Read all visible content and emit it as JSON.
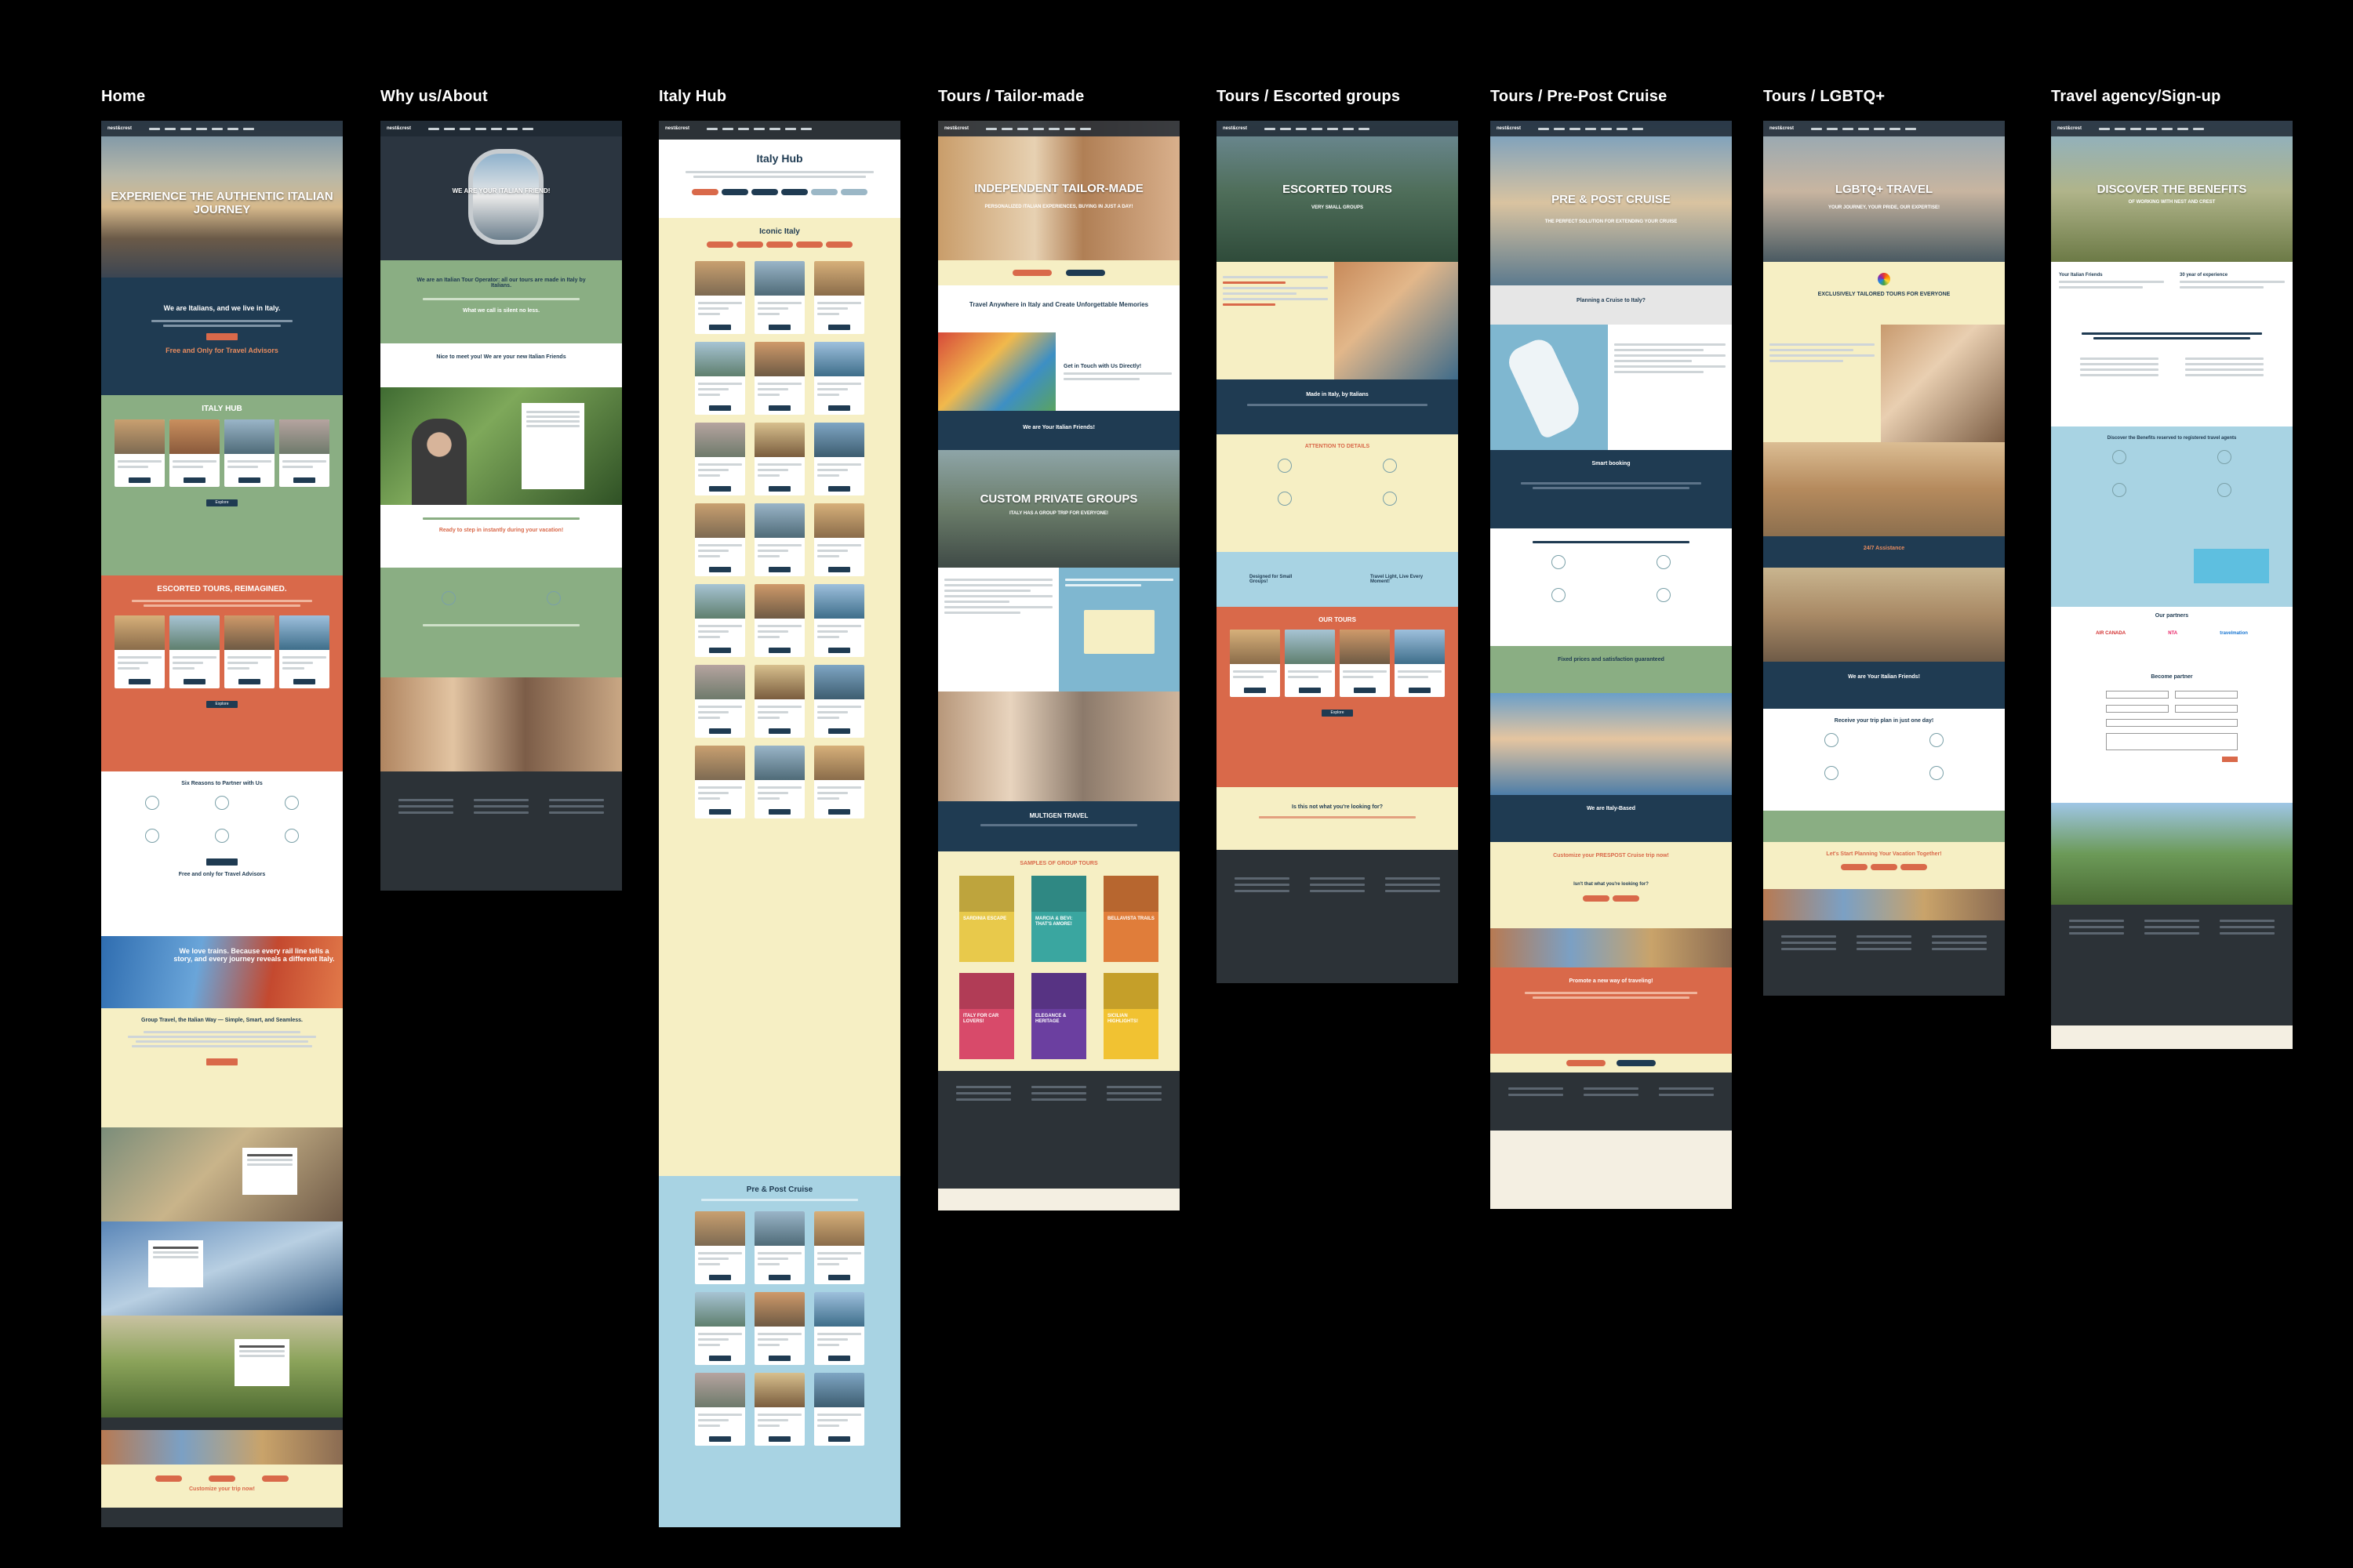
{
  "board": {
    "titles": [
      "Home",
      "Why us/About",
      "Italy Hub",
      "Tours / Tailor-made",
      "Tours / Escorted groups",
      "Tours / Pre-Post Cruise",
      "Tours / LGBTQ+",
      "Travel agency/Sign-up"
    ]
  },
  "home": {
    "hero_title": "EXPERIENCE THE AUTHENTIC ITALIAN JOURNEY",
    "intro": "We are Italians, and we live in Italy.",
    "advisors": "Free and Only for Travel Advisors",
    "hub": "ITALY HUB",
    "explore": "Explore",
    "escorted": "ESCORTED TOURS, REIMAGINED.",
    "partner": "Six Reasons to Partner with Us",
    "free_only": "Free and only for Travel Advisors",
    "trains": "We love trains. Because every rail line tells a story, and every journey reveals a different Italy.",
    "group": "Group Travel, the Italian Way — Simple, Smart, and Seamless.",
    "customize": "Customize your trip now!"
  },
  "about": {
    "hero_title": "WE ARE YOUR ITALIAN FRIEND!",
    "operator": "We are an Italian Tour Operator: all our tours are made in Italy by Italians.",
    "not_alone": "What we call is silent no less.",
    "meet": "Nice to meet you! We are your new Italian Friends",
    "ready": "Ready to step in instantly during your vacation!"
  },
  "hub": {
    "title": "Italy Hub",
    "iconic": "Iconic Italy",
    "cruise": "Pre & Post Cruise"
  },
  "tailor": {
    "hero_title": "INDEPENDENT TAILOR-MADE",
    "hero_sub": "PERSONALIZED ITALIAN EXPERIENCES, BUYING IN JUST A DAY!",
    "anywhere": "Travel Anywhere in Italy and Create Unforgettable Memories",
    "touch": "Get in Touch with Us Directly!",
    "friends": "We are Your Italian Friends!",
    "private": "CUSTOM PRIVATE GROUPS",
    "private_sub": "ITALY HAS A GROUP TRIP FOR EVERYONE!",
    "multigen": "MULTIGEN TRAVEL",
    "samples": "SAMPLES OF GROUP TOURS",
    "samples_list": [
      "SARDINIA ESCAPE",
      "MARCIA & BEVI: THAT'S AMORE!",
      "BELLAVISTA TRAILS",
      "ITALY FOR CAR LOVERS!",
      "ELEGANCE & HERITAGE",
      "SICILIAN HIGHLIGHTS!"
    ]
  },
  "escorted": {
    "hero_title": "ESCORTED TOURS",
    "hero_sub": "VERY SMALL GROUPS",
    "made": "Made in Italy, by Italians",
    "attention": "ATTENTION TO DETAILS",
    "small": "Designed for Small Groups!",
    "travel_light": "Travel Light, Live Every Moment!",
    "our_tours": "OUR TOURS",
    "explore": "Explore",
    "looking": "Is this not what you're looking for?"
  },
  "cruise": {
    "hero_title": "PRE & POST CRUISE",
    "hero_sub": "THE PERFECT SOLUTION FOR EXTENDING YOUR CRUISE",
    "planning": "Planning a Cruise to Italy?",
    "smart": "Smart booking",
    "fixed": "Fixed prices and satisfaction guaranteed",
    "italy_based": "We are Italy-Based",
    "customize": "Customize your PRESPOST Cruise trip now!",
    "looking": "Isn't that what you're looking for?",
    "promote": "Promote a new way of traveling!"
  },
  "lgbtq": {
    "hero_title": "LGBTQ+ TRAVEL",
    "hero_sub": "YOUR JOURNEY, YOUR PRIDE, OUR EXPERTISE!",
    "tailored": "EXCLUSIVELY TAILORED TOURS FOR EVERYONE",
    "assistance": "24/7 Assistance",
    "friends": "We are Your Italian Friends!",
    "receive": "Receive your trip plan in just one day!",
    "lets": "Let's Start Planning Your Vacation Together!"
  },
  "agency": {
    "hero_title": "DISCOVER THE BENEFITS",
    "hero_sub": "OF WORKING WITH NEST AND CREST",
    "friends": "Your Italian Friends",
    "years": "30 year of experience",
    "discover": "Discover the Benefits reserved to registered travel agents",
    "partners": "Our partners",
    "partner_names": [
      "AIR CANADA",
      "NTA",
      "travelmation"
    ],
    "become": "Become partner"
  },
  "colors": {
    "navy": "#1f3b52",
    "coral": "#d9694a",
    "sage": "#8aae83",
    "cream": "#f6efc4",
    "sky": "#a8d3e3",
    "dark": "#2c3237"
  }
}
